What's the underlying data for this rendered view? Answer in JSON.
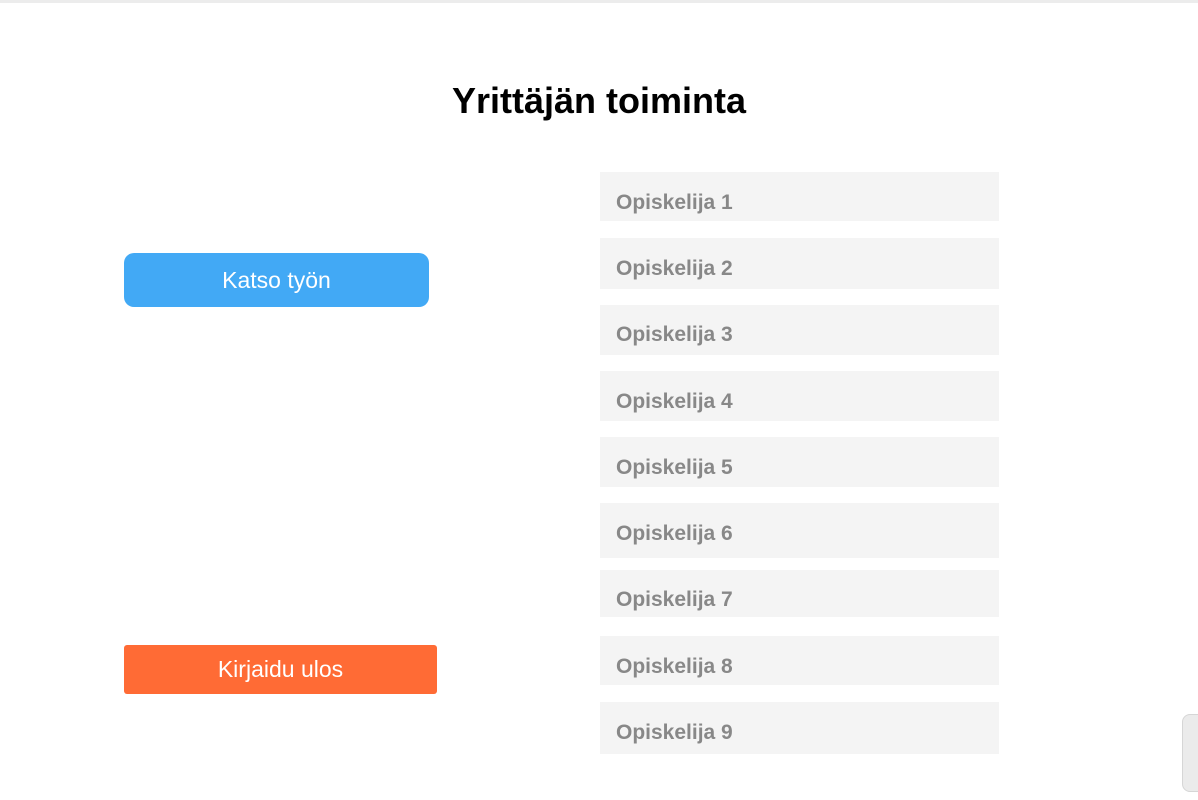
{
  "page": {
    "title": "Yrittäjän toiminta"
  },
  "buttons": {
    "view_work": "Katso työn",
    "logout": "Kirjaidu ulos"
  },
  "students": [
    {
      "label": "Opiskelija 1"
    },
    {
      "label": "Opiskelija 2"
    },
    {
      "label": "Opiskelija 3"
    },
    {
      "label": "Opiskelija 4"
    },
    {
      "label": "Opiskelija 5"
    },
    {
      "label": "Opiskelija 6"
    },
    {
      "label": "Opiskelija 7"
    },
    {
      "label": "Opiskelija 8"
    },
    {
      "label": "Opiskelija 9"
    }
  ],
  "colors": {
    "primary": "#42a9f5",
    "danger": "#ff6b35",
    "item_bg": "#f4f4f4",
    "item_text": "#888888"
  }
}
